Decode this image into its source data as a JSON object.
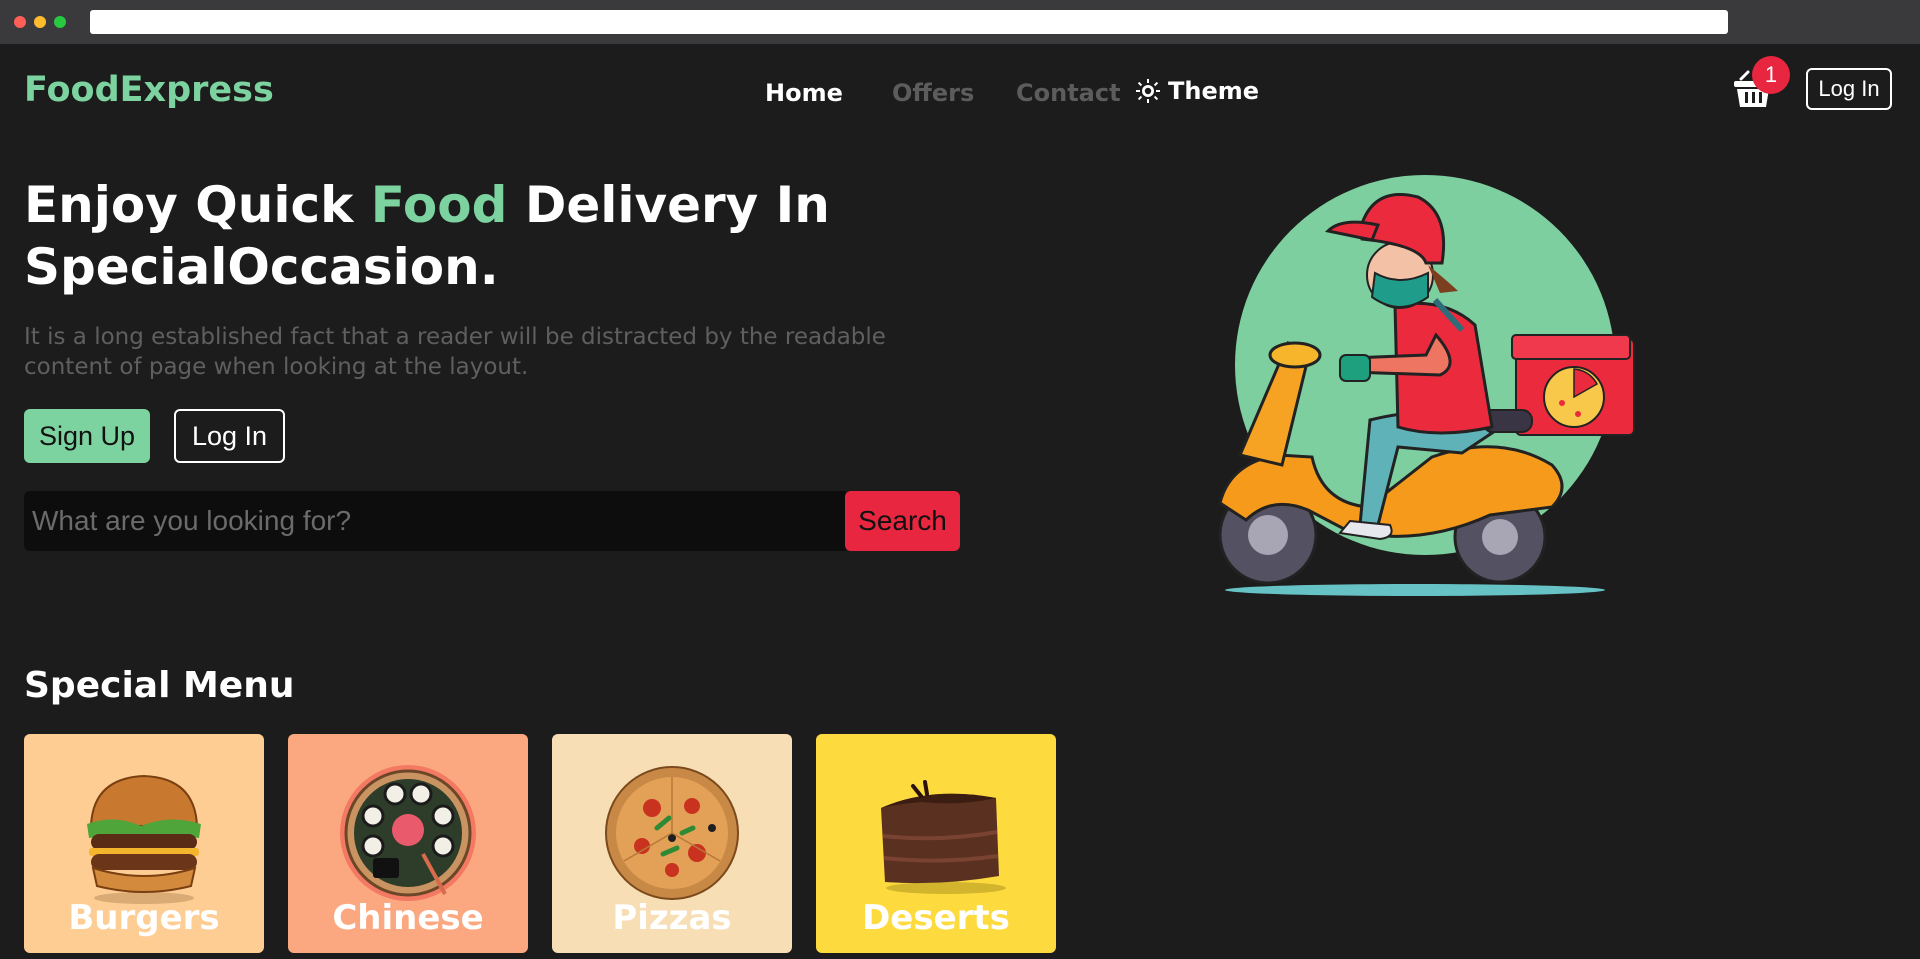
{
  "brand": {
    "name": "FoodExpress",
    "accent_color": "#7dd3a0"
  },
  "nav": {
    "links": [
      "Home",
      "Offers",
      "Contact"
    ],
    "active": "Home",
    "theme_label": "Theme",
    "cart_count": "1",
    "login_label": "Log In"
  },
  "hero": {
    "title_part1": "Enjoy Quick ",
    "title_accent": "Food",
    "title_part2": " Delivery In SpecialOccasion.",
    "description": "It is a long established fact that a reader will be distracted by the readable content of page when looking at the layout.",
    "signup_label": "Sign Up",
    "login_label": "Log In"
  },
  "search": {
    "placeholder": "What are you looking for?",
    "value": "",
    "button_label": "Search"
  },
  "menu": {
    "title": "Special Menu",
    "items": [
      {
        "label": "Burgers",
        "color": "#fdcd94",
        "icon": "burger-image"
      },
      {
        "label": "Chinese",
        "color": "#fba880",
        "icon": "sushi-image"
      },
      {
        "label": "Pizzas",
        "color": "#f8deb5",
        "icon": "pizza-image"
      },
      {
        "label": "Deserts",
        "color": "#fddb3f",
        "icon": "cake-image"
      }
    ]
  },
  "colors": {
    "background": "#1c1c1c",
    "search_button": "#e8263f",
    "cart_badge": "#e8263f",
    "muted_text": "#5f5f5f"
  }
}
